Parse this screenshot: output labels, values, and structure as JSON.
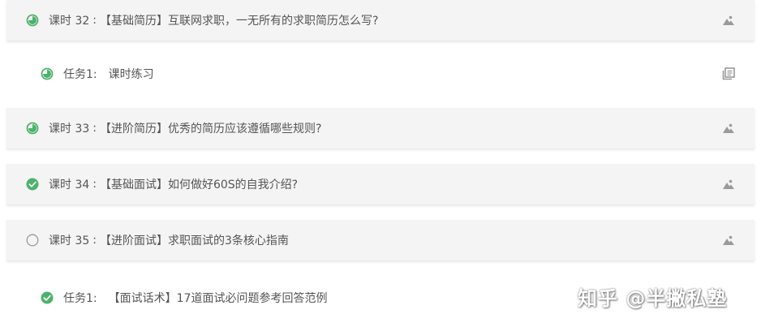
{
  "colors": {
    "accent_green": "#4cb26b",
    "empty_circle": "#9a9a9a",
    "icon_gray": "#9a9a9a",
    "lesson_bg": "#f4f4f4"
  },
  "items": [
    {
      "kind": "lesson",
      "status": "partial",
      "number": "课时 32",
      "separator": ":",
      "title": "【基础简历】互联网求职，一无所有的求职简历怎么写?",
      "right_icon": "image-icon"
    },
    {
      "kind": "task",
      "status": "partial",
      "label": "任务1:",
      "title": "课时练习",
      "right_icon": "exercise-icon"
    },
    {
      "kind": "lesson",
      "status": "partial",
      "number": "课时 33",
      "separator": ":",
      "title": "【进阶简历】优秀的简历应该遵循哪些规则?",
      "right_icon": "image-icon"
    },
    {
      "kind": "lesson",
      "status": "done",
      "number": "课时 34",
      "separator": ":",
      "title": "【基础面试】如何做好60S的自我介绍?",
      "right_icon": "image-icon"
    },
    {
      "kind": "lesson",
      "status": "empty",
      "number": "课时 35",
      "separator": ":",
      "title": "【进阶面试】求职面试的3条核心指南",
      "right_icon": "image-icon"
    },
    {
      "kind": "task",
      "status": "done",
      "label": "任务1:",
      "title": "【面试话术】17道面试必问题参考回答范例",
      "right_icon": ""
    }
  ],
  "watermark": "知乎 @半撇私塾"
}
